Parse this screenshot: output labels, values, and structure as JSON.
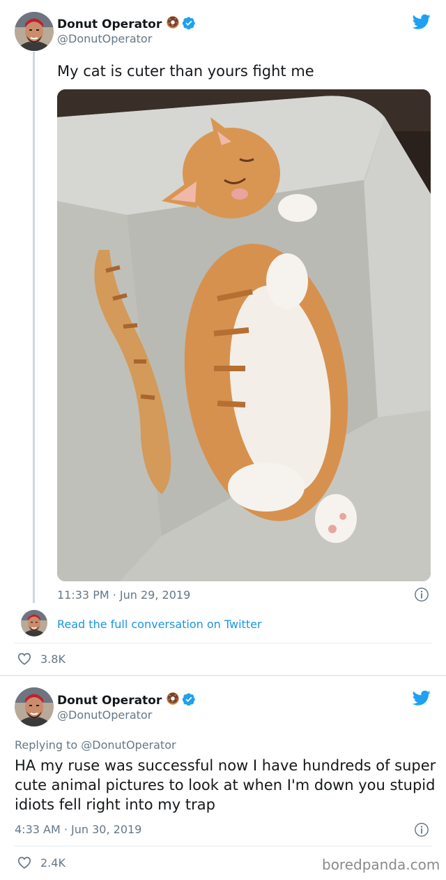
{
  "tweet1": {
    "name": "Donut Operator",
    "handle": "@DonutOperator",
    "text": "My cat is cuter than yours fight me",
    "timestamp": "11:33 PM · Jun 29, 2019",
    "read_more": "Read the full conversation on Twitter",
    "likes": "3.8K"
  },
  "tweet2": {
    "name": "Donut Operator",
    "handle": "@DonutOperator",
    "replying_to": "Replying to @DonutOperator",
    "text": "HA my ruse was successful now I have hundreds of super cute animal pictures to look at when I'm down you stupid idiots fell right into my trap",
    "timestamp": "4:33 AM · Jun 30, 2019",
    "likes": "2.4K"
  },
  "watermark": "boredpanda.com",
  "colors": {
    "twitter_blue": "#1da1f2",
    "link_blue": "#1b95e0",
    "muted": "#657786",
    "divider": "#e6ecf0"
  }
}
